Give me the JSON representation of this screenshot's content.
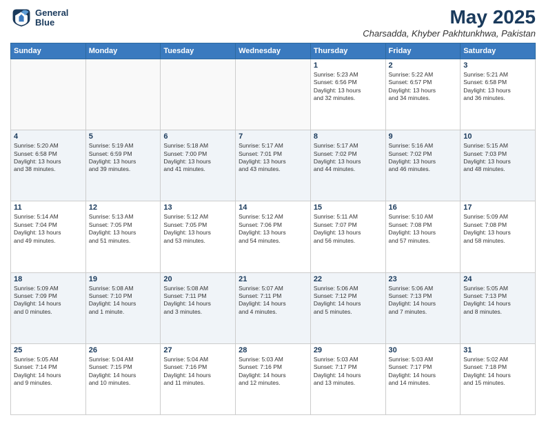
{
  "header": {
    "logo_line1": "General",
    "logo_line2": "Blue",
    "month_year": "May 2025",
    "location": "Charsadda, Khyber Pakhtunkhwa, Pakistan"
  },
  "weekdays": [
    "Sunday",
    "Monday",
    "Tuesday",
    "Wednesday",
    "Thursday",
    "Friday",
    "Saturday"
  ],
  "weeks": [
    [
      {
        "day": "",
        "info": ""
      },
      {
        "day": "",
        "info": ""
      },
      {
        "day": "",
        "info": ""
      },
      {
        "day": "",
        "info": ""
      },
      {
        "day": "1",
        "info": "Sunrise: 5:23 AM\nSunset: 6:56 PM\nDaylight: 13 hours\nand 32 minutes."
      },
      {
        "day": "2",
        "info": "Sunrise: 5:22 AM\nSunset: 6:57 PM\nDaylight: 13 hours\nand 34 minutes."
      },
      {
        "day": "3",
        "info": "Sunrise: 5:21 AM\nSunset: 6:58 PM\nDaylight: 13 hours\nand 36 minutes."
      }
    ],
    [
      {
        "day": "4",
        "info": "Sunrise: 5:20 AM\nSunset: 6:58 PM\nDaylight: 13 hours\nand 38 minutes."
      },
      {
        "day": "5",
        "info": "Sunrise: 5:19 AM\nSunset: 6:59 PM\nDaylight: 13 hours\nand 39 minutes."
      },
      {
        "day": "6",
        "info": "Sunrise: 5:18 AM\nSunset: 7:00 PM\nDaylight: 13 hours\nand 41 minutes."
      },
      {
        "day": "7",
        "info": "Sunrise: 5:17 AM\nSunset: 7:01 PM\nDaylight: 13 hours\nand 43 minutes."
      },
      {
        "day": "8",
        "info": "Sunrise: 5:17 AM\nSunset: 7:02 PM\nDaylight: 13 hours\nand 44 minutes."
      },
      {
        "day": "9",
        "info": "Sunrise: 5:16 AM\nSunset: 7:02 PM\nDaylight: 13 hours\nand 46 minutes."
      },
      {
        "day": "10",
        "info": "Sunrise: 5:15 AM\nSunset: 7:03 PM\nDaylight: 13 hours\nand 48 minutes."
      }
    ],
    [
      {
        "day": "11",
        "info": "Sunrise: 5:14 AM\nSunset: 7:04 PM\nDaylight: 13 hours\nand 49 minutes."
      },
      {
        "day": "12",
        "info": "Sunrise: 5:13 AM\nSunset: 7:05 PM\nDaylight: 13 hours\nand 51 minutes."
      },
      {
        "day": "13",
        "info": "Sunrise: 5:12 AM\nSunset: 7:05 PM\nDaylight: 13 hours\nand 53 minutes."
      },
      {
        "day": "14",
        "info": "Sunrise: 5:12 AM\nSunset: 7:06 PM\nDaylight: 13 hours\nand 54 minutes."
      },
      {
        "day": "15",
        "info": "Sunrise: 5:11 AM\nSunset: 7:07 PM\nDaylight: 13 hours\nand 56 minutes."
      },
      {
        "day": "16",
        "info": "Sunrise: 5:10 AM\nSunset: 7:08 PM\nDaylight: 13 hours\nand 57 minutes."
      },
      {
        "day": "17",
        "info": "Sunrise: 5:09 AM\nSunset: 7:08 PM\nDaylight: 13 hours\nand 58 minutes."
      }
    ],
    [
      {
        "day": "18",
        "info": "Sunrise: 5:09 AM\nSunset: 7:09 PM\nDaylight: 14 hours\nand 0 minutes."
      },
      {
        "day": "19",
        "info": "Sunrise: 5:08 AM\nSunset: 7:10 PM\nDaylight: 14 hours\nand 1 minute."
      },
      {
        "day": "20",
        "info": "Sunrise: 5:08 AM\nSunset: 7:11 PM\nDaylight: 14 hours\nand 3 minutes."
      },
      {
        "day": "21",
        "info": "Sunrise: 5:07 AM\nSunset: 7:11 PM\nDaylight: 14 hours\nand 4 minutes."
      },
      {
        "day": "22",
        "info": "Sunrise: 5:06 AM\nSunset: 7:12 PM\nDaylight: 14 hours\nand 5 minutes."
      },
      {
        "day": "23",
        "info": "Sunrise: 5:06 AM\nSunset: 7:13 PM\nDaylight: 14 hours\nand 7 minutes."
      },
      {
        "day": "24",
        "info": "Sunrise: 5:05 AM\nSunset: 7:13 PM\nDaylight: 14 hours\nand 8 minutes."
      }
    ],
    [
      {
        "day": "25",
        "info": "Sunrise: 5:05 AM\nSunset: 7:14 PM\nDaylight: 14 hours\nand 9 minutes."
      },
      {
        "day": "26",
        "info": "Sunrise: 5:04 AM\nSunset: 7:15 PM\nDaylight: 14 hours\nand 10 minutes."
      },
      {
        "day": "27",
        "info": "Sunrise: 5:04 AM\nSunset: 7:16 PM\nDaylight: 14 hours\nand 11 minutes."
      },
      {
        "day": "28",
        "info": "Sunrise: 5:03 AM\nSunset: 7:16 PM\nDaylight: 14 hours\nand 12 minutes."
      },
      {
        "day": "29",
        "info": "Sunrise: 5:03 AM\nSunset: 7:17 PM\nDaylight: 14 hours\nand 13 minutes."
      },
      {
        "day": "30",
        "info": "Sunrise: 5:03 AM\nSunset: 7:17 PM\nDaylight: 14 hours\nand 14 minutes."
      },
      {
        "day": "31",
        "info": "Sunrise: 5:02 AM\nSunset: 7:18 PM\nDaylight: 14 hours\nand 15 minutes."
      }
    ]
  ]
}
